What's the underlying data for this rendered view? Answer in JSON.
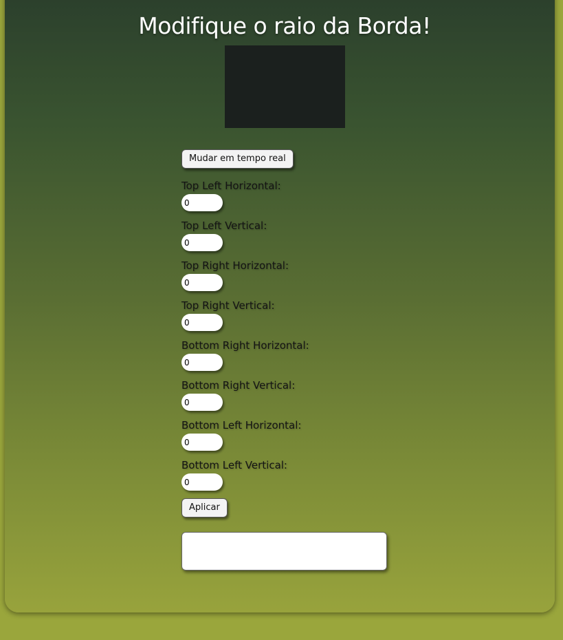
{
  "page": {
    "title": "Modifique o raio da Borda!"
  },
  "preview": {
    "color": "#1b201e"
  },
  "controls": {
    "realtime_label": "Mudar em tempo real",
    "apply_label": "Aplicar"
  },
  "fields": [
    {
      "label": "Top Left Horizontal:",
      "value": "0"
    },
    {
      "label": "Top Left Vertical:",
      "value": "0"
    },
    {
      "label": "Top Right Horizontal:",
      "value": "0"
    },
    {
      "label": "Top Right Vertical:",
      "value": "0"
    },
    {
      "label": "Bottom Right Horizontal:",
      "value": "0"
    },
    {
      "label": "Bottom Right Vertical:",
      "value": "0"
    },
    {
      "label": "Bottom Left Horizontal:",
      "value": "0"
    },
    {
      "label": "Bottom Left Vertical:",
      "value": "0"
    }
  ],
  "output": {
    "text": ""
  },
  "colors": {
    "gradient_top": "#2a3e2c",
    "gradient_bottom": "#98a33c",
    "page_background": "#9aa63c"
  }
}
